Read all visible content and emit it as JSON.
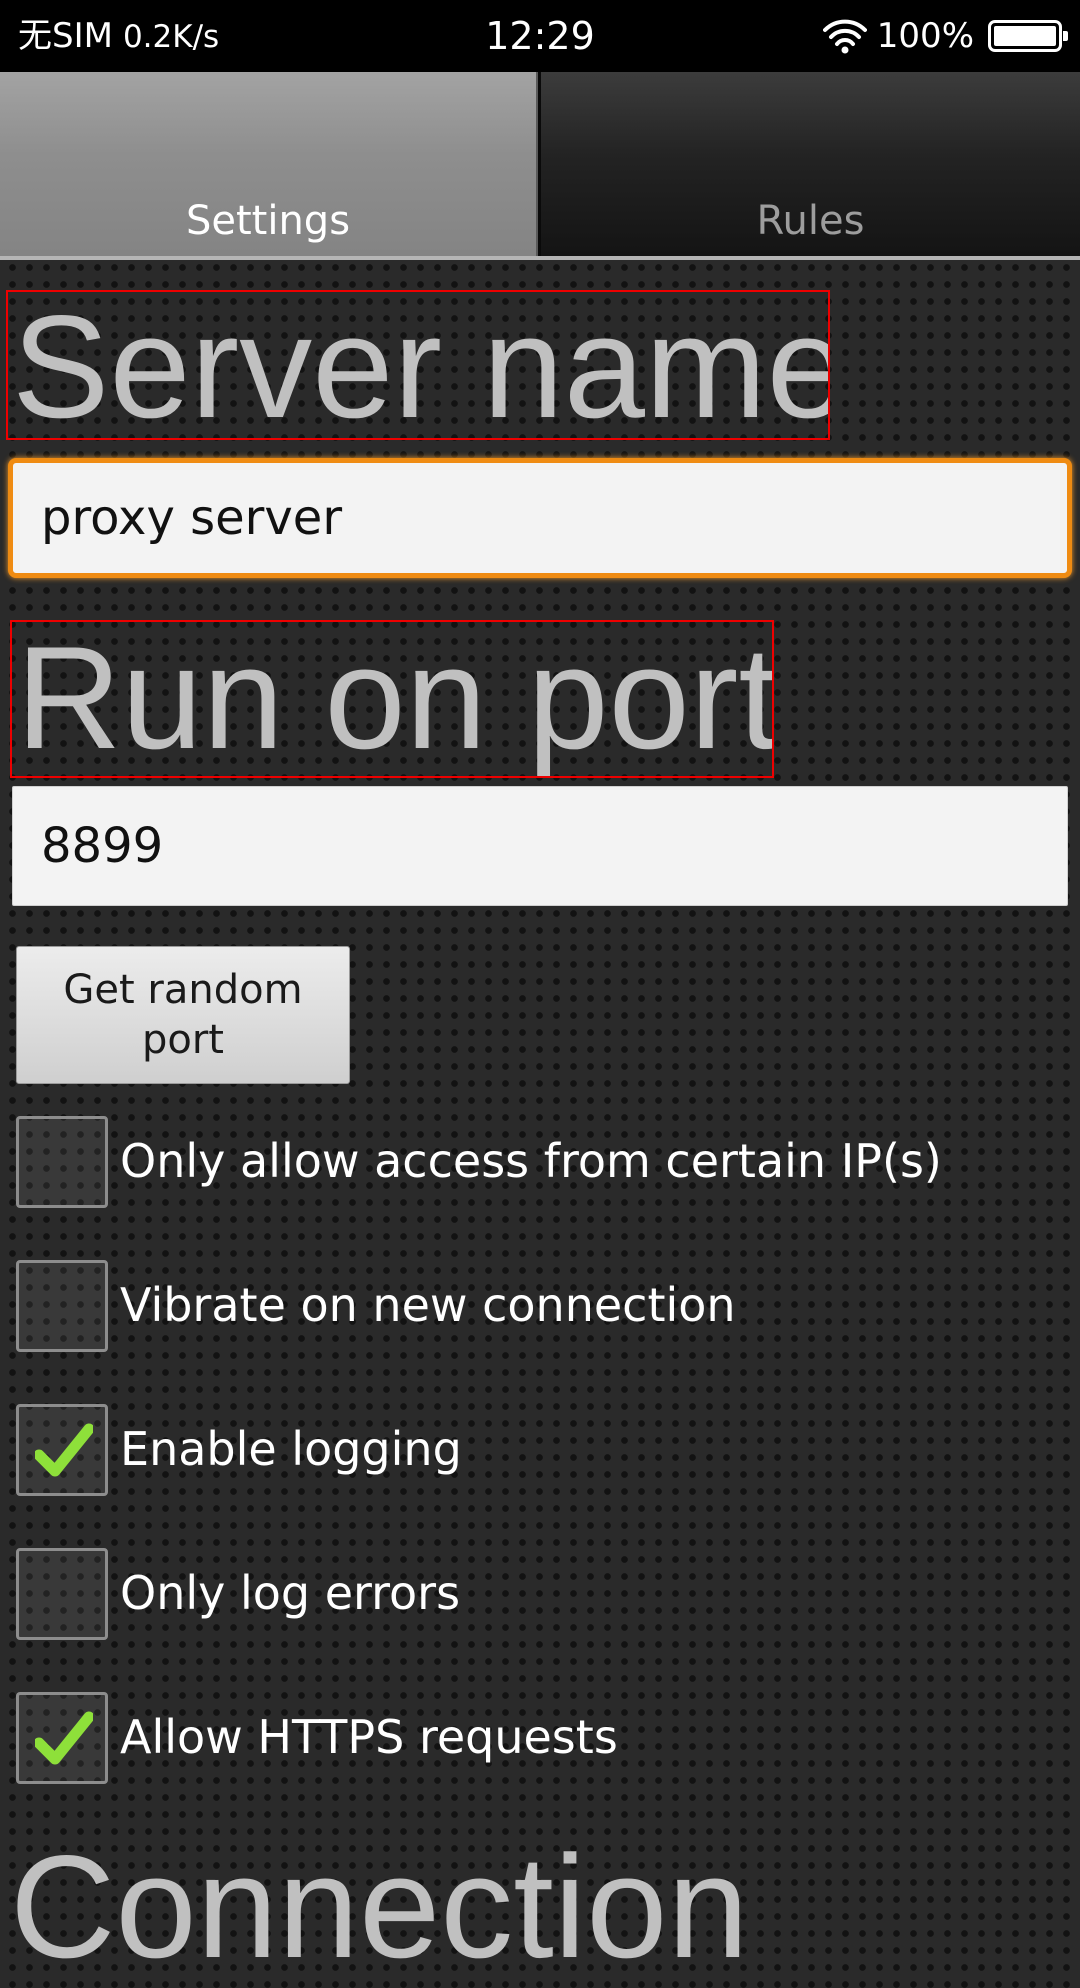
{
  "status_bar": {
    "carrier": "无SIM",
    "network_speed": "0.2K/s",
    "time": "12:29",
    "battery": "100%"
  },
  "tabs": [
    {
      "label": "Settings",
      "selected": true
    },
    {
      "label": "Rules",
      "selected": false
    }
  ],
  "settings": {
    "server_name_heading": "Server name",
    "server_name_value": "proxy server",
    "port_heading": "Run on port",
    "port_value": "8899",
    "random_port_button": "Get random port",
    "options": [
      {
        "label": "Only allow access from certain IP(s)",
        "checked": false
      },
      {
        "label": "Vibrate on new connection",
        "checked": false
      },
      {
        "label": "Enable logging",
        "checked": true
      },
      {
        "label": "Only log errors",
        "checked": false
      },
      {
        "label": "Allow HTTPS requests",
        "checked": true
      }
    ],
    "connection_heading": "Connection"
  },
  "colors": {
    "focus_border": "#ef8b12",
    "checkmark": "#8ee03a",
    "heading_highlight": "#ee0000"
  },
  "icons": [
    "wifi-icon",
    "battery-icon",
    "checkmark-icon"
  ]
}
